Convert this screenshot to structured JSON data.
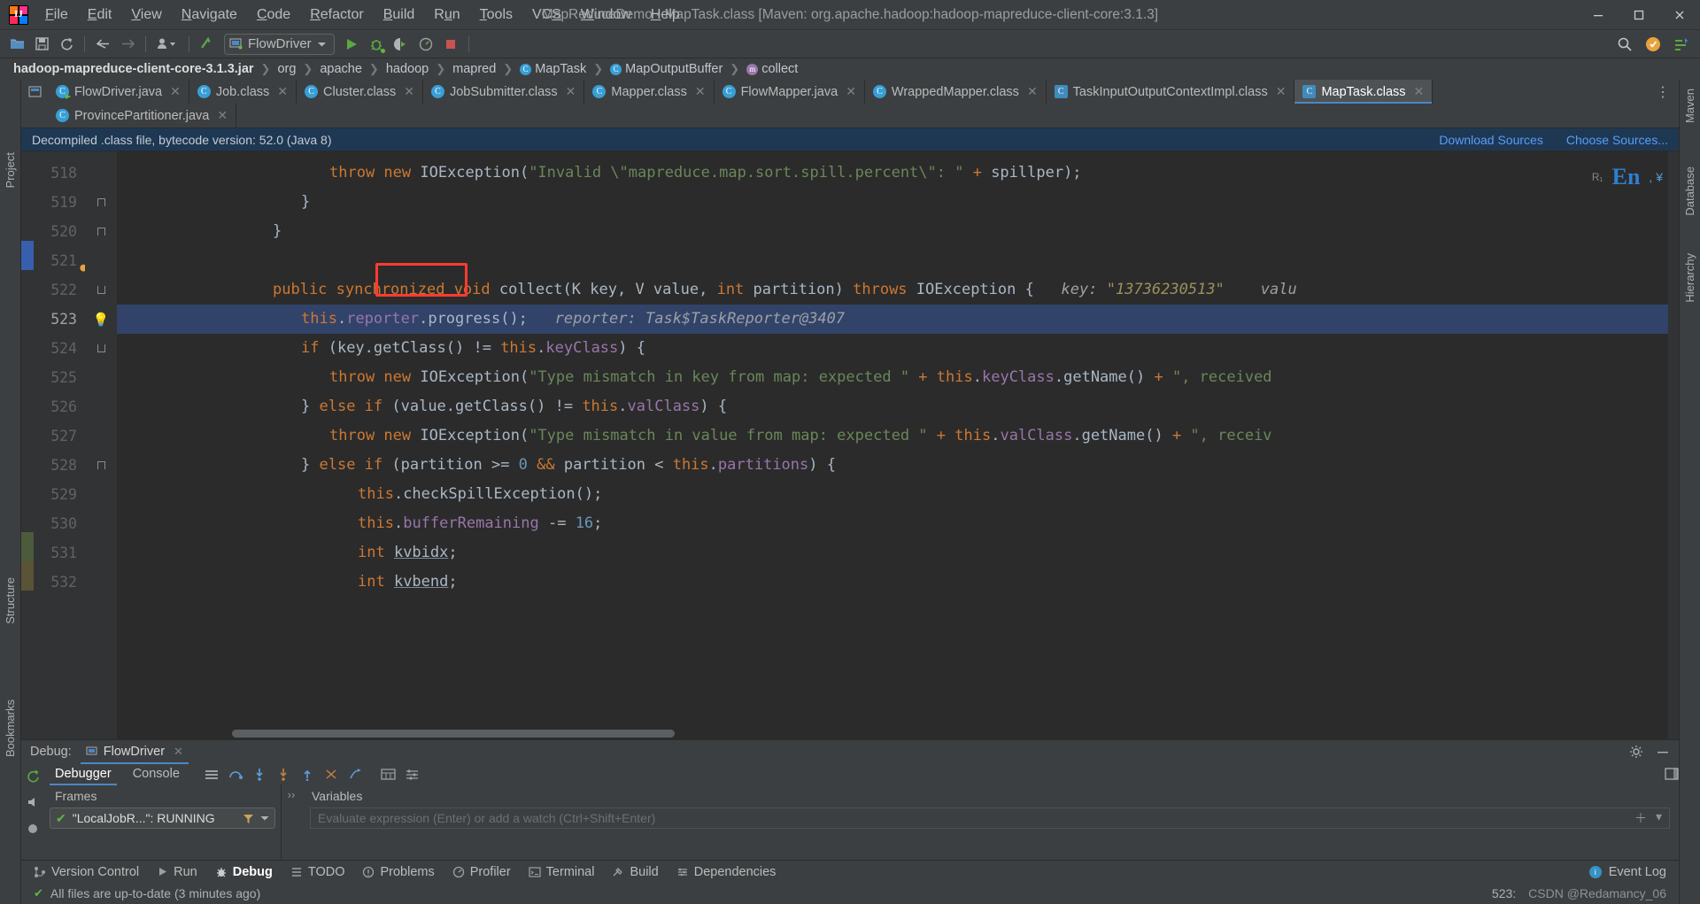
{
  "window": {
    "title": "MapReduceDemo - MapTask.class [Maven: org.apache.hadoop:hadoop-mapreduce-client-core:3.1.3]",
    "minimize": "—",
    "maximize": "❐",
    "close": "✕"
  },
  "menubar": [
    {
      "label": "File",
      "mnemonic": "F"
    },
    {
      "label": "Edit",
      "mnemonic": "E"
    },
    {
      "label": "View",
      "mnemonic": "V"
    },
    {
      "label": "Navigate",
      "mnemonic": "N"
    },
    {
      "label": "Code",
      "mnemonic": "C"
    },
    {
      "label": "Refactor",
      "mnemonic": "R"
    },
    {
      "label": "Build",
      "mnemonic": "B"
    },
    {
      "label": "Run",
      "mnemonic": "u"
    },
    {
      "label": "Tools",
      "mnemonic": "T"
    },
    {
      "label": "VCS",
      "mnemonic": "S"
    },
    {
      "label": "Window",
      "mnemonic": "W"
    },
    {
      "label": "Help",
      "mnemonic": "H"
    }
  ],
  "toolbar": {
    "open_label": "open-project",
    "save_label": "save-all",
    "sync_label": "synchronize",
    "back_label": "back",
    "forward_label": "forward",
    "profile_label": "manage-profiles",
    "update_label": "update-project",
    "run_config": "FlowDriver",
    "run_label": "Run",
    "debug_label": "Debug",
    "coverage_label": "Run with Coverage",
    "profiler_label": "Profile",
    "stop_label": "Stop",
    "search_label": "Search Everywhere",
    "settings_label": "Settings"
  },
  "breadcrumb": [
    {
      "label": "hadoop-mapreduce-client-core-3.1.3.jar",
      "icon": "jar-icon",
      "bold": true
    },
    {
      "label": "org",
      "icon": "folder-icon"
    },
    {
      "label": "apache",
      "icon": "folder-icon"
    },
    {
      "label": "hadoop",
      "icon": "folder-icon"
    },
    {
      "label": "mapred",
      "icon": "folder-icon"
    },
    {
      "label": "MapTask",
      "icon": "class-icon"
    },
    {
      "label": "MapOutputBuffer",
      "icon": "class-icon"
    },
    {
      "label": "collect",
      "icon": "method-icon"
    }
  ],
  "editor_tabs_row1": [
    {
      "label": "FlowDriver.java",
      "icon": "java-run-icon",
      "active": false
    },
    {
      "label": "Job.class",
      "icon": "class-icon",
      "active": false
    },
    {
      "label": "Cluster.class",
      "icon": "class-icon",
      "active": false
    },
    {
      "label": "JobSubmitter.class",
      "icon": "class-icon",
      "active": false
    },
    {
      "label": "Mapper.class",
      "icon": "class-icon",
      "active": false
    },
    {
      "label": "FlowMapper.java",
      "icon": "class-icon",
      "active": false
    },
    {
      "label": "WrappedMapper.class",
      "icon": "class-icon",
      "active": false
    },
    {
      "label": "TaskInputOutputContextImpl.class",
      "icon": "lib-class-icon",
      "active": false
    },
    {
      "label": "MapTask.class",
      "icon": "lib-class-icon",
      "active": true
    }
  ],
  "editor_tabs_row2": [
    {
      "label": "ProvincePartitioner.java",
      "icon": "class-icon",
      "active": false
    }
  ],
  "banner": {
    "text": "Decompiled .class file, bytecode version: 52.0 (Java 8)",
    "download_sources": "Download Sources",
    "choose_sources": "Choose Sources..."
  },
  "code": {
    "first_line": 518,
    "lines": [
      {
        "num": 518,
        "indent": 0
      },
      {
        "num": 519,
        "indent": 0
      },
      {
        "num": 520,
        "indent": 0
      },
      {
        "num": 521,
        "indent": 0
      },
      {
        "num": 522,
        "indent": 0
      },
      {
        "num": 523,
        "indent": 0
      },
      {
        "num": 524,
        "indent": 0
      },
      {
        "num": 525,
        "indent": 0
      },
      {
        "num": 526,
        "indent": 0
      },
      {
        "num": 527,
        "indent": 0
      },
      {
        "num": 528,
        "indent": 0
      },
      {
        "num": 529,
        "indent": 0
      },
      {
        "num": 530,
        "indent": 0
      },
      {
        "num": 531,
        "indent": 0
      },
      {
        "num": 532,
        "indent": 0
      }
    ],
    "highlighted_line": 523,
    "breakpoint_line": 523,
    "current_line_marker": 522,
    "selected_token": "collect(",
    "inlay_522_key": "key:",
    "inlay_522_keyval": "\"13736230513\"",
    "inlay_522_value": "valu",
    "inlay_523_reporter": "reporter:",
    "inlay_523_value": "Task$TaskReporter@3407",
    "text_518": "throw new IOException(\"Invalid \\\"mapreduce.map.sort.spill.percent\\\": \" + spillper);",
    "text_519": "}",
    "text_520": "}",
    "text_521": "",
    "text_522": "public synchronized void collect(K key, V value, int partition) throws IOException {",
    "text_523": "this.reporter.progress();",
    "text_524": "if (key.getClass() != this.keyClass) {",
    "text_525": "throw new IOException(\"Type mismatch in key from map: expected \" + this.keyClass.getName() + \", received",
    "text_526": "} else if (value.getClass() != this.valClass) {",
    "text_527": "throw new IOException(\"Type mismatch in value from map: expected \" + this.valClass.getName() + \", receiv",
    "text_528": "} else if (partition >= 0 && partition < this.partitions) {",
    "text_529": "this.checkSpillException();",
    "text_530": "this.bufferRemaining -= 16;",
    "text_531": "int kvbidx;",
    "text_532": "int kvbend;"
  },
  "ime": {
    "prefix": "R₁",
    "label": "En",
    "suffix": ", ¥"
  },
  "left_strip": [
    {
      "label": "Project"
    },
    {
      "label": "Structure"
    },
    {
      "label": "Bookmarks"
    }
  ],
  "right_strip": [
    {
      "label": "Maven"
    },
    {
      "label": "Database"
    },
    {
      "label": "Hierarchy"
    }
  ],
  "debug": {
    "panel_title": "Debug:",
    "session_tab": "FlowDriver",
    "tabs": [
      {
        "label": "Debugger",
        "selected": true
      },
      {
        "label": "Console",
        "selected": false
      }
    ],
    "frames_title": "Frames",
    "frame_item": "\"LocalJobR...\": RUNNING",
    "variables_title": "Variables",
    "watch_placeholder": "Evaluate expression (Enter) or add a watch (Ctrl+Shift+Enter)",
    "settings_icon": "gear-icon",
    "minimize_icon": "minimize-icon",
    "restore_icon": "restore-icon",
    "toolbar_icons": [
      "show-execution-point-icon",
      "step-over-icon",
      "step-into-icon",
      "force-step-into-icon",
      "step-out-icon",
      "drop-frame-icon",
      "run-to-cursor-icon",
      "evaluate-expression-icon",
      "layout-icon"
    ]
  },
  "toolwindow_bar": [
    {
      "label": "Version Control",
      "icon": "branch-icon",
      "selected": false
    },
    {
      "label": "Run",
      "icon": "play-icon",
      "selected": false
    },
    {
      "label": "Debug",
      "icon": "bug-icon",
      "selected": true
    },
    {
      "label": "TODO",
      "icon": "list-icon",
      "selected": false
    },
    {
      "label": "Problems",
      "icon": "warning-icon",
      "selected": false
    },
    {
      "label": "Profiler",
      "icon": "profiler-icon",
      "selected": false
    },
    {
      "label": "Terminal",
      "icon": "terminal-icon",
      "selected": false
    },
    {
      "label": "Build",
      "icon": "hammer-icon",
      "selected": false
    },
    {
      "label": "Dependencies",
      "icon": "dependencies-icon",
      "selected": false
    }
  ],
  "statusbar": {
    "message": "All files are up-to-date (3 minutes ago)",
    "caret_position": "523:",
    "event_log": "Event Log",
    "watermark": "CSDN @Redamancy_06"
  },
  "colors": {
    "accent_blue": "#4a88c7",
    "banner_bg": "#1e3853",
    "editor_bg": "#2b2b2b",
    "gutter_bg": "#313335",
    "chrome_bg": "#3c3f41",
    "highlight_line": "#32436a",
    "red_box": "#ff3b30",
    "keyword": "#cc7832",
    "string": "#6a8759",
    "number": "#6897bb",
    "field": "#9876aa",
    "text": "#a9b7c6",
    "green_run": "#62b543",
    "link": "#589df6"
  }
}
